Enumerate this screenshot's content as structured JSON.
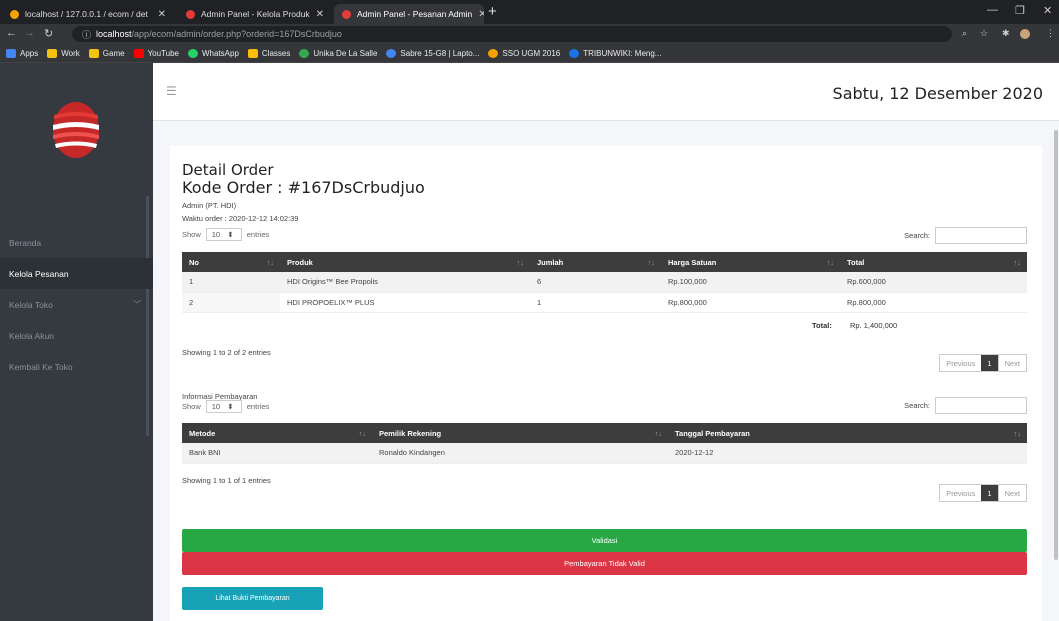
{
  "browser": {
    "tabs": [
      {
        "title": "localhost / 127.0.0.1 / ecom / det",
        "color": "#f4a300"
      },
      {
        "title": "Admin Panel - Kelola Produk",
        "color": "#e33b3b"
      },
      {
        "title": "Admin Panel - Pesanan Admin",
        "color": "#e33b3b"
      }
    ],
    "url_host": "localhost",
    "url_path": "/app/ecom/admin/order.php?orderid=167DsCrbudjuo",
    "bookmarks": [
      {
        "label": "Apps",
        "color": "#4285f4"
      },
      {
        "label": "Work",
        "color": "#f4c20d"
      },
      {
        "label": "Game",
        "color": "#f4c20d"
      },
      {
        "label": "YouTube",
        "color": "#ff0000"
      },
      {
        "label": "WhatsApp",
        "color": "#25d366"
      },
      {
        "label": "Classes",
        "color": "#fbbc04"
      },
      {
        "label": "Unika De La Salle",
        "color": "#34a853"
      },
      {
        "label": "Sabre 15-G8 | Lapto...",
        "color": "#4285f4"
      },
      {
        "label": "SSO UGM 2016",
        "color": "#f4a300"
      },
      {
        "label": "TRIBUNWIKI: Meng...",
        "color": "#1a73e8"
      }
    ]
  },
  "sidebar": {
    "items": [
      {
        "label": "Beranda"
      },
      {
        "label": "Kelola Pesanan"
      },
      {
        "label": "Kelola Toko"
      },
      {
        "label": "Kelola Akun"
      },
      {
        "label": "Kembali Ke Toko"
      }
    ]
  },
  "header": {
    "date": "Sabtu, 12 Desember 2020"
  },
  "order": {
    "title": "Detail Order",
    "code": "Kode Order : #167DsCrbudjuo",
    "admin": "Admin (PT. HDI)",
    "time": "Waktu order : 2020-12-12 14:02:39"
  },
  "table1": {
    "show_label": "Show",
    "entries_label": "entries",
    "page_size": "10",
    "search_label": "Search:",
    "columns": [
      "No",
      "Produk",
      "Jumlah",
      "Harga Satuan",
      "Total"
    ],
    "rows": [
      [
        "1",
        "HDI Origins™ Bee Propolis",
        "6",
        "Rp.100,000",
        "Rp.600,000"
      ],
      [
        "2",
        "HDI PROPOELIX™ PLUS",
        "1",
        "Rp.800,000",
        "Rp.800,000"
      ]
    ],
    "total_label": "Total:",
    "total_value": "Rp. 1,400,000",
    "info": "Showing 1 to 2 of 2 entries",
    "pager": {
      "prev": "Previous",
      "page": "1",
      "next": "Next"
    }
  },
  "payment": {
    "heading": "Informasi Pembayaran",
    "show_label": "Show",
    "entries_label": "entries",
    "page_size": "10",
    "search_label": "Search:",
    "columns": [
      "Metode",
      "Pemilik Rekening",
      "Tanggal Pembayaran"
    ],
    "rows": [
      [
        "Bank BNI",
        "Ronaldo Kindangen",
        "2020-12-12"
      ]
    ],
    "info": "Showing 1 to 1 of 1 entries",
    "pager": {
      "prev": "Previous",
      "page": "1",
      "next": "Next"
    }
  },
  "actions": {
    "validate": "Validasi",
    "invalid": "Pembayaran Tidak Valid",
    "view_proof": "Lihat Bukti Pembayaran"
  }
}
